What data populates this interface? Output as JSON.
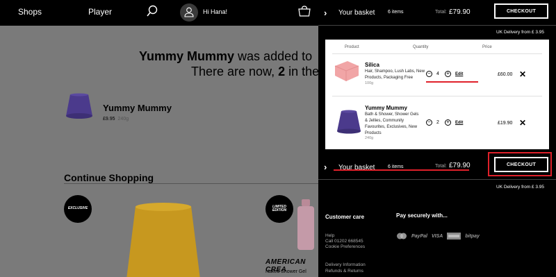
{
  "nav": {
    "shops": "Shops",
    "player": "Player",
    "greeting": "Hi Hana!"
  },
  "page": {
    "added_name": "Yummy Mummy",
    "added_suffix": " was added to",
    "count_prefix": "There are now, ",
    "count": "2",
    "count_suffix": " in the",
    "product_name": "Yummy Mummy",
    "product_price": "£9.95",
    "product_weight": "240g",
    "continue_title": "Continue Shopping",
    "badge_exclusive": "EXCLUSIVE",
    "badge_limited": "LIMITED EDITION",
    "american_title": "AMERICAN CREA",
    "american_sub": "Naked Shower Gel"
  },
  "basket": {
    "title": "Your basket",
    "items_count": "6 items",
    "total_label": "Total:",
    "total_value": "£79.90",
    "checkout_label": "CHECKOUT",
    "delivery": "UK Delivery from £ 3.95",
    "headers": {
      "product": "Product",
      "quantity": "Quantity",
      "price": "Price"
    },
    "items": [
      {
        "name": "Silica",
        "tags": "Hair, Shampoo, Lush Labs, New Products, Packaging Free",
        "weight": "100g",
        "qty": "4",
        "edit": "Edit",
        "price": "£60.00"
      },
      {
        "name": "Yummy Mummy",
        "tags": "Bath & Shower, Shower Gels & Jellies, Community Favourites, Exclusives, New Products",
        "weight": "240g",
        "qty": "2",
        "edit": "Edit",
        "price": "£19.90"
      }
    ],
    "remove_glyph": "✕",
    "minus_glyph": "−",
    "plus_glyph": "+"
  },
  "footer": {
    "customer_care": "Customer care",
    "pay_securely": "Pay securely with...",
    "links": [
      "Help",
      "Call 01202 668545",
      "Cookie Preferences",
      "Delivery Information",
      "Refunds & Returns"
    ],
    "pay_methods": [
      "PayPal",
      "VISA",
      "bitpay"
    ]
  },
  "colors": {
    "accent_red": "#e0202a",
    "panel_bg": "#000000",
    "overlay_bg": "#7a7a7a"
  }
}
